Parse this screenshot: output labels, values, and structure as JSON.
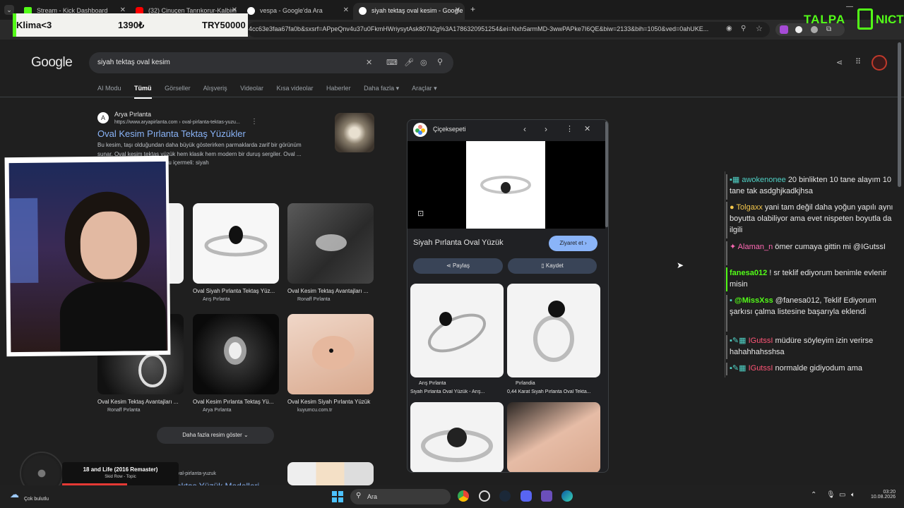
{
  "tabs": [
    {
      "label": "Stream - Kick Dashboard",
      "color": "#53fc18"
    },
    {
      "label": "(32) Cinuçen Tanrıkorur-Kalbim",
      "color": "#ff0000"
    },
    {
      "label": "vespa - Google'da Ara",
      "color": "#ffffff"
    },
    {
      "label": "siyah tektaş oval kesim - Google",
      "color": "#ffffff"
    }
  ],
  "new_tab": "+",
  "url": "4cc63e3faa67fa0b&sxsrf=APpeQnv4u37u0FkmHWriysytAsk807li2g%3A1786320951254&ei=Nxh5armMD-3wwPAPke7I6QE&biw=2133&bih=1050&ved=0ahUKE...",
  "overlay": {
    "item": "Klima<3",
    "price": "1390₺",
    "goal": "TRY50000"
  },
  "stream_brand": {
    "left": "TALPA",
    "right": "NICT"
  },
  "google": {
    "logo": "Google",
    "query": "siyah tektaş oval kesim"
  },
  "nav": [
    "AI Modu",
    "Tümü",
    "Görseller",
    "Alışveriş",
    "Videolar",
    "Kısa videolar",
    "Haberler",
    "Daha fazla ▾",
    "Araçlar ▾"
  ],
  "result": {
    "site": "Arya Pırlanta",
    "url": "https://www.aryapirlanta.com › oval-pirlanta-tektas-yuzu...",
    "title": "Oval Kesim Pırlanta Tektaş Yüzükler",
    "snippet": "Bu kesim, taşı olduğundan daha büyük gösterirken parmaklarda zarif bir görünüm sunar. Oval kesim tektaş yüzük hem klasik hem modern bir duruş sergiler. Oval ...",
    "extra": "Eksik: Oval PURLANTA  Şunu içermeli: siyah"
  },
  "images": [
    {
      "cap": "Oval Siyah Pırlanta Tektaş Yüz...",
      "src": "Arış Pırlanta"
    },
    {
      "cap": "Oval Kesim Tektaş Avantajları ...",
      "src": "Ronaff Pırlanta"
    },
    {
      "cap": "Oval Kesim Tektaş Avantajları ...",
      "src": "Ronaff Pırlanta"
    },
    {
      "cap": "Oval Kesim Pırlanta Tektaş Yü...",
      "src": "Arya Pırlanta"
    },
    {
      "cap": "Oval Kesim Siyah Pırlanta Yüzük",
      "src": "kuyumcu.com.tr"
    }
  ],
  "more_images": "Daha fazla resim göster",
  "bottom_url": "https://... › oval-pirlanta-yuzuk",
  "bottom_title": "Tektaş Yüzük Modelleri",
  "panel": {
    "source": "Çiçeksepeti",
    "title": "Siyah Pırlanta Oval Yüzük",
    "visit": "Ziyaret et",
    "share": "Paylaş",
    "save": "Kaydet",
    "related": [
      {
        "src": "Arış Pırlanta",
        "cap": "Siyah Pırlanta Oval Yüzük - Arış..."
      },
      {
        "src": "Pırlandia",
        "cap": "0,44 Karat Siyah Pırlanta Oval Tekta..."
      }
    ]
  },
  "chat": [
    {
      "user": "awokenonee",
      "color": "#4fd1c5",
      "text": "20 binlikten 10 tane alayım 10 tane tak asdghjkadkjhsa"
    },
    {
      "user": "Tolgaxx",
      "color": "#f6c84c",
      "text": "yani tam değil daha yoğun yapılı aynı boyutta olabiliyor ama evet nispeten boyutla da ilgili"
    },
    {
      "user": "Alaman_n",
      "color": "#ff69b4",
      "text": "ömer cumaya gittin mi @IGutssI"
    },
    {
      "user": "fanesa012",
      "color": "#53fc18",
      "text": "! sr teklif ediyorum benimle evlenir misin"
    },
    {
      "user": "@MissXss",
      "color": "#53fc18",
      "text": "@fanesa012, Teklif Ediyorum şarkısı çalma listesine başarıyla eklendi"
    },
    {
      "user": "IGutssI",
      "color": "#ff5577",
      "text": "müdüre söyleyim izin verirse hahahhahsshsa"
    },
    {
      "user": "IGutssI",
      "color": "#ff5577",
      "text": "normalde gidiyodum ama"
    }
  ],
  "music": {
    "title": "18 and Life (2016 Remaster)",
    "artist": "Skid Row - Topic"
  },
  "taskbar": {
    "weather": "Çok bulutlu",
    "search": "Ara",
    "time": "03:20",
    "date": "10.08.2026"
  }
}
